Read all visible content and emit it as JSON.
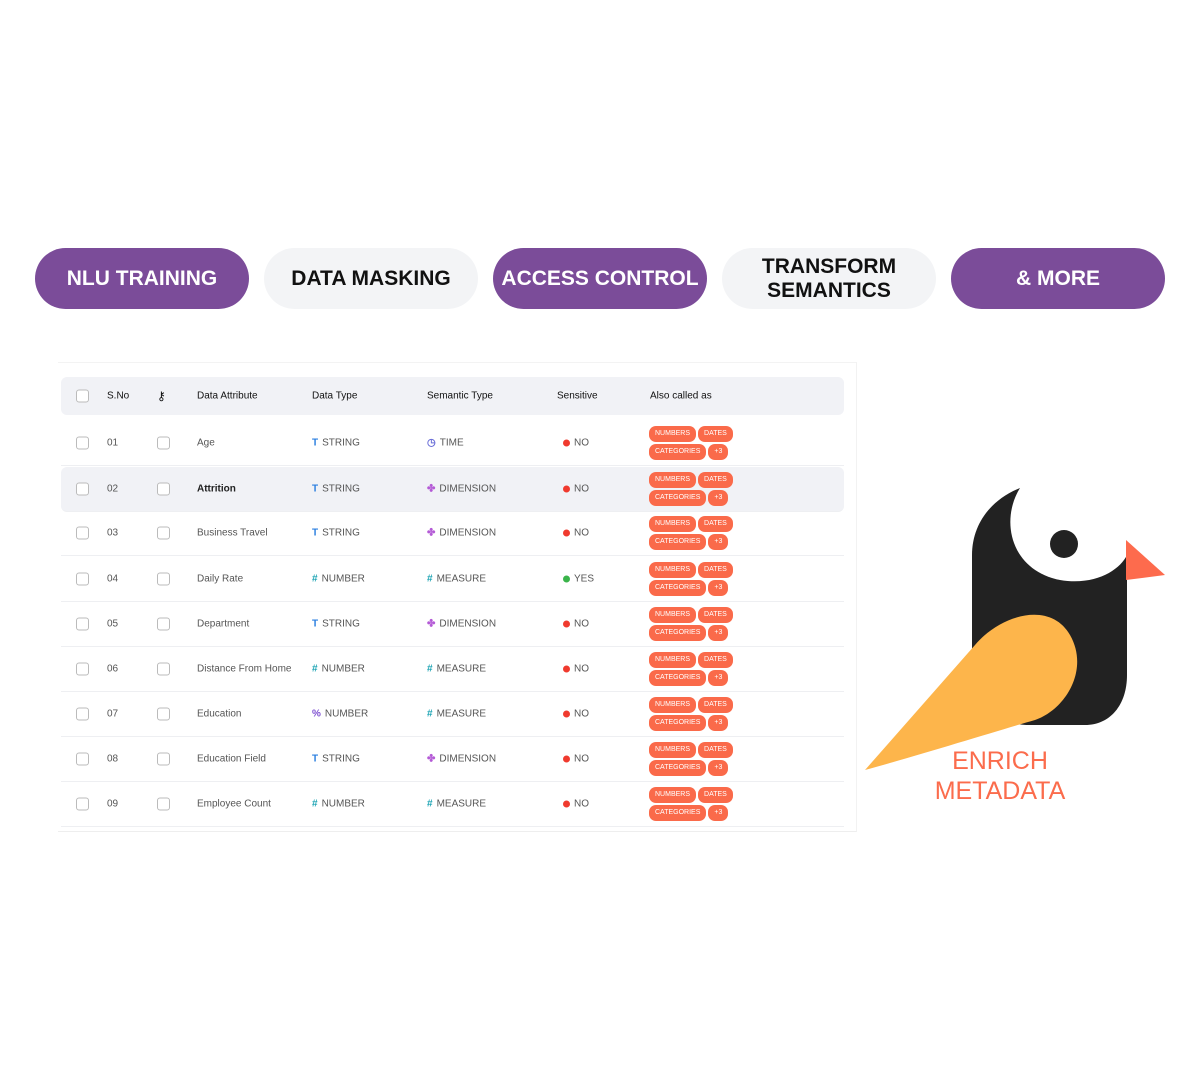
{
  "pills": [
    {
      "label": "NLU TRAINING",
      "style": "purple"
    },
    {
      "label": "DATA MASKING",
      "style": "light"
    },
    {
      "label": "ACCESS CONTROL",
      "style": "purple"
    },
    {
      "label": "TRANSFORM\nSEMANTICS",
      "style": "light"
    },
    {
      "label": "& MORE",
      "style": "purple"
    }
  ],
  "colors": {
    "purple": "#7b4c99",
    "tag": "#fa6a4a",
    "no": "#f03a2e",
    "yes": "#3ab44a"
  },
  "table": {
    "headers": {
      "sno": "S.No",
      "key_icon": "key-icon",
      "attr": "Data Attribute",
      "type": "Data Type",
      "semantic": "Semantic Type",
      "sensitive": "Sensitive",
      "also": "Also called as"
    },
    "rows": [
      {
        "sno": "01",
        "attr": "Age",
        "type": "STRING",
        "type_icon": "T",
        "semantic": "TIME",
        "sem_icon": "clock",
        "sensitive": "NO",
        "tags": [
          "NUMBERS",
          "DATES",
          "CATEGORIES",
          "+3"
        ]
      },
      {
        "sno": "02",
        "attr": "Attrition",
        "type": "STRING",
        "type_icon": "T",
        "semantic": "DIMENSION",
        "sem_icon": "dim",
        "sensitive": "NO",
        "tags": [
          "NUMBERS",
          "DATES",
          "CATEGORIES",
          "+3"
        ],
        "highlighted": true
      },
      {
        "sno": "03",
        "attr": "Business Travel",
        "type": "STRING",
        "type_icon": "T",
        "semantic": "DIMENSION",
        "sem_icon": "dim",
        "sensitive": "NO",
        "tags": [
          "NUMBERS",
          "DATES",
          "CATEGORIES",
          "+3"
        ]
      },
      {
        "sno": "04",
        "attr": "Daily Rate",
        "type": "NUMBER",
        "type_icon": "#",
        "semantic": "MEASURE",
        "sem_icon": "#",
        "sensitive": "YES",
        "tags": [
          "NUMBERS",
          "DATES",
          "CATEGORIES",
          "+3"
        ]
      },
      {
        "sno": "05",
        "attr": "Department",
        "type": "STRING",
        "type_icon": "T",
        "semantic": "DIMENSION",
        "sem_icon": "dim",
        "sensitive": "NO",
        "tags": [
          "NUMBERS",
          "DATES",
          "CATEGORIES",
          "+3"
        ]
      },
      {
        "sno": "06",
        "attr": "Distance From Home",
        "type": "NUMBER",
        "type_icon": "#",
        "semantic": "MEASURE",
        "sem_icon": "#",
        "sensitive": "NO",
        "tags": [
          "NUMBERS",
          "DATES",
          "CATEGORIES",
          "+3"
        ]
      },
      {
        "sno": "07",
        "attr": "Education",
        "type": "NUMBER",
        "type_icon": "%",
        "semantic": "MEASURE",
        "sem_icon": "#",
        "sensitive": "NO",
        "tags": [
          "NUMBERS",
          "DATES",
          "CATEGORIES",
          "+3"
        ]
      },
      {
        "sno": "08",
        "attr": "Education Field",
        "type": "STRING",
        "type_icon": "T",
        "semantic": "DIMENSION",
        "sem_icon": "dim",
        "sensitive": "NO",
        "tags": [
          "NUMBERS",
          "DATES",
          "CATEGORIES",
          "+3"
        ]
      },
      {
        "sno": "09",
        "attr": "Employee Count",
        "type": "NUMBER",
        "type_icon": "#",
        "semantic": "MEASURE",
        "sem_icon": "#",
        "sensitive": "NO",
        "tags": [
          "NUMBERS",
          "DATES",
          "CATEGORIES",
          "+3"
        ]
      }
    ]
  },
  "logo": {
    "line1": "ENRICH",
    "line2": "METADATA"
  }
}
